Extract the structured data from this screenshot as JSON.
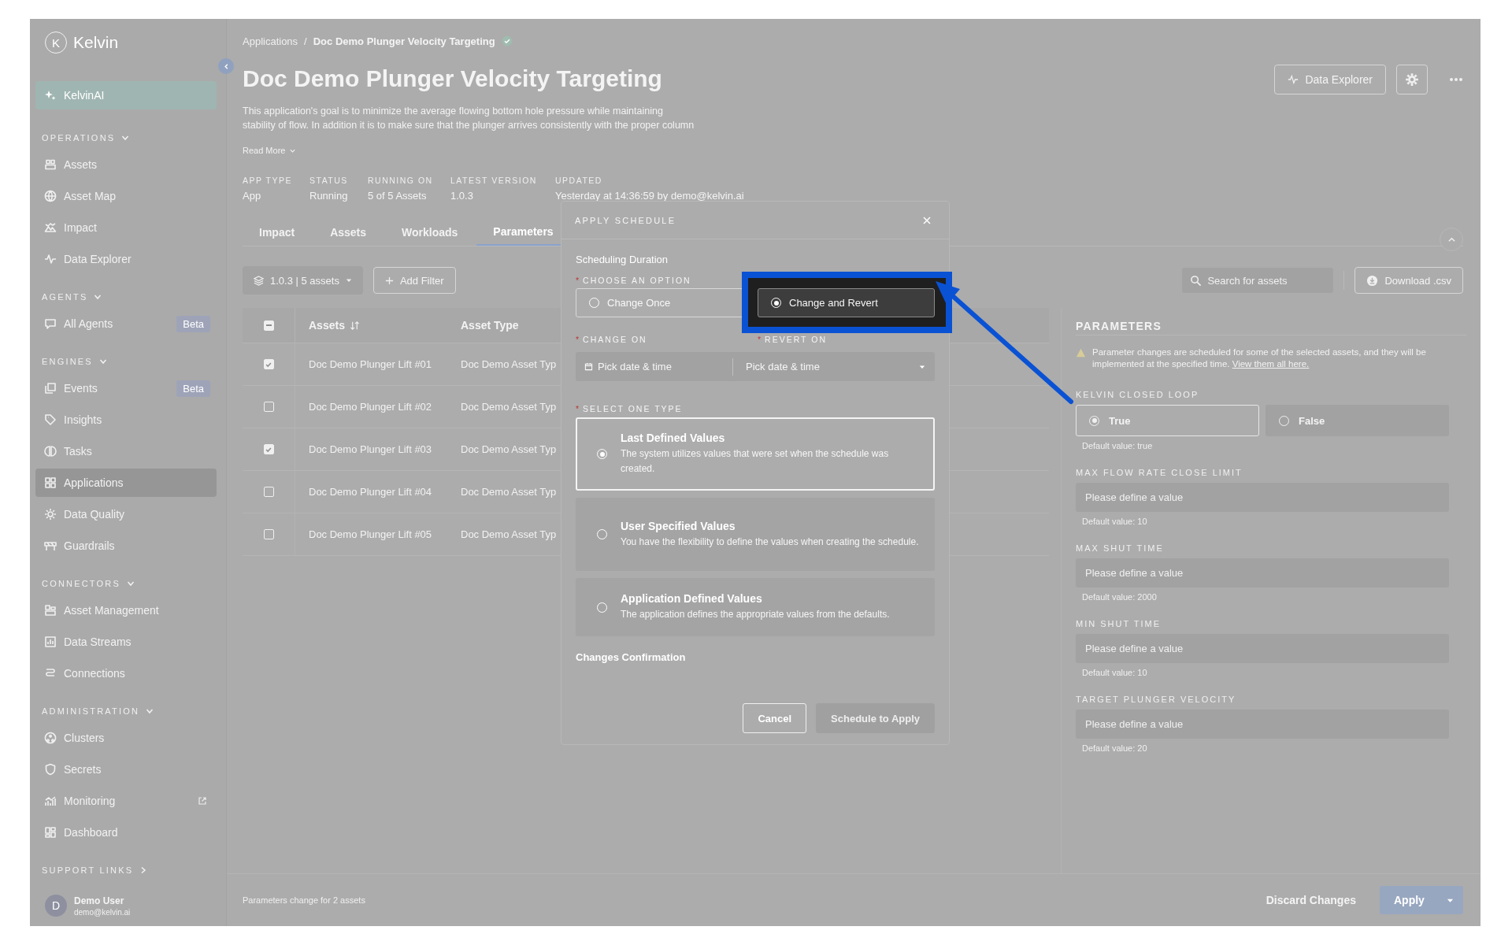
{
  "sidebar": {
    "logo_mark": "K",
    "logo": "Kelvin",
    "ai_button": "KelvinAI",
    "sections": [
      {
        "title": "OPERATIONS",
        "expanded": true,
        "items": [
          {
            "label": "Assets",
            "selected": false,
            "external": false
          },
          {
            "label": "Asset Map",
            "selected": false,
            "external": false
          },
          {
            "label": "Impact",
            "selected": false,
            "external": false
          },
          {
            "label": "Data Explorer",
            "selected": false,
            "external": false
          }
        ]
      },
      {
        "title": "AGENTS",
        "expanded": true,
        "items": [
          {
            "label": "All Agents",
            "selected": false,
            "external": false,
            "badge": "Beta"
          }
        ]
      },
      {
        "title": "ENGINES",
        "expanded": true,
        "items": [
          {
            "label": "Events",
            "selected": false,
            "external": false,
            "badge": "Beta"
          },
          {
            "label": "Insights",
            "selected": false,
            "external": false
          },
          {
            "label": "Tasks",
            "selected": false,
            "external": false
          },
          {
            "label": "Applications",
            "selected": true,
            "external": false
          },
          {
            "label": "Data Quality",
            "selected": false,
            "external": false
          },
          {
            "label": "Guardrails",
            "selected": false,
            "external": false
          }
        ]
      },
      {
        "title": "CONNECTORS",
        "expanded": true,
        "items": [
          {
            "label": "Asset Management",
            "selected": false,
            "external": false
          },
          {
            "label": "Data Streams",
            "selected": false,
            "external": false
          },
          {
            "label": "Connections",
            "selected": false,
            "external": false
          }
        ]
      },
      {
        "title": "ADMINISTRATION",
        "expanded": true,
        "items": [
          {
            "label": "Clusters",
            "selected": false,
            "external": false
          },
          {
            "label": "Secrets",
            "selected": false,
            "external": false
          },
          {
            "label": "Monitoring",
            "selected": false,
            "external": true
          },
          {
            "label": "Dashboard",
            "selected": false,
            "external": false
          }
        ]
      },
      {
        "title": "SUPPORT LINKS",
        "expanded": false
      }
    ],
    "user": {
      "avatar": "D",
      "name": "Demo User",
      "email": "demo@kelvin.ai"
    }
  },
  "breadcrumb": {
    "items": [
      "Applications",
      "Doc Demo Plunger Velocity Targeting"
    ],
    "separator": "/"
  },
  "title": "Doc Demo Plunger Velocity Targeting",
  "description_lines": [
    "This application's goal is to minimize the average flowing bottom hole pressure while maintaining",
    "stability of flow. In addition it is to make sure that the plunger arrives consistently with the proper column"
  ],
  "read_more": "Read More",
  "meta": [
    {
      "label": "APP TYPE",
      "value": "App"
    },
    {
      "label": "STATUS",
      "value": "Running"
    },
    {
      "label": "RUNNING ON",
      "value": "5 of 5 Assets"
    },
    {
      "label": "LATEST VERSION",
      "value": "1.0.3"
    },
    {
      "label": "UPDATED",
      "value": "Yesterday at 14:36:59 by demo@kelvin.ai"
    }
  ],
  "actions": {
    "data_explorer": "Data Explorer"
  },
  "tabs": [
    {
      "label": "Impact",
      "selected": false
    },
    {
      "label": "Assets",
      "selected": false
    },
    {
      "label": "Workloads",
      "selected": false
    },
    {
      "label": "Parameters",
      "selected": true
    }
  ],
  "filters": {
    "version": "1.0.3 | 5 assets",
    "add_filter": "Add Filter",
    "search_placeholder": "Search for assets",
    "download": "Download .csv"
  },
  "table": {
    "select_all": {
      "indeterminate": true
    },
    "columns": [
      "Assets",
      "Asset Type"
    ],
    "rows": [
      {
        "checked": true,
        "asset": "Doc Demo Plunger Lift #01",
        "type": "Doc Demo Asset Typ"
      },
      {
        "checked": false,
        "asset": "Doc Demo Plunger Lift #02",
        "type": "Doc Demo Asset Typ"
      },
      {
        "checked": true,
        "asset": "Doc Demo Plunger Lift #03",
        "type": "Doc Demo Asset Typ"
      },
      {
        "checked": false,
        "asset": "Doc Demo Plunger Lift #04",
        "type": "Doc Demo Asset Typ"
      },
      {
        "checked": false,
        "asset": "Doc Demo Plunger Lift #05",
        "type": "Doc Demo Asset Typ"
      }
    ]
  },
  "parameters": {
    "title": "PARAMETERS",
    "warning": "Parameter changes are scheduled for some of the selected assets, and they will be implemented at the specified time.",
    "warning_link": "View them all here.",
    "items": [
      {
        "kind": "radio",
        "label": "KELVIN CLOSED LOOP",
        "options": [
          {
            "label": "True",
            "selected": true
          },
          {
            "label": "False",
            "selected": false
          }
        ],
        "default": "Default value: true"
      },
      {
        "kind": "input",
        "label": "MAX FLOW RATE CLOSE LIMIT",
        "placeholder": "Please define a value",
        "default": "Default value: 10"
      },
      {
        "kind": "input",
        "label": "MAX SHUT TIME",
        "placeholder": "Please define a value",
        "default": "Default value: 2000"
      },
      {
        "kind": "input",
        "label": "MIN SHUT TIME",
        "placeholder": "Please define a value",
        "default": "Default value: 10"
      },
      {
        "kind": "input",
        "label": "TARGET PLUNGER VELOCITY",
        "placeholder": "Please define a value",
        "default": "Default value: 20"
      }
    ]
  },
  "footer": {
    "note": "Parameters change for 2 assets",
    "discard": "Discard Changes",
    "apply": "Apply"
  },
  "modal": {
    "title": "APPLY SCHEDULE",
    "section_title": "Scheduling Duration",
    "option_label": {
      "mark": "*",
      "text": "CHOOSE AN OPTION"
    },
    "options": [
      {
        "label": "Change Once",
        "selected": false,
        "highlighted": false
      },
      {
        "label": "Change and Revert",
        "selected": true,
        "highlighted": true
      }
    ],
    "change_on": {
      "mark": "*",
      "text": "CHANGE ON",
      "placeholder": "Pick date & time"
    },
    "revert_on": {
      "mark": "*",
      "text": "REVERT ON",
      "placeholder": "Pick date & time"
    },
    "type_label": {
      "mark": "*",
      "text": "SELECT ONE TYPE"
    },
    "types": [
      {
        "title": "Last Defined Values",
        "description": "The system utilizes values that were set when the schedule was created.",
        "selected": true
      },
      {
        "title": "User Specified Values",
        "description": "You have the flexibility to define the values when creating the schedule.",
        "selected": false
      },
      {
        "title": "Application Defined Values",
        "description": "The application defines the appropriate values from the defaults.",
        "selected": false
      }
    ],
    "confirmation": "Changes Confirmation",
    "buttons": [
      {
        "label": "Cancel",
        "disabled": false
      },
      {
        "label": "Schedule to Apply",
        "disabled": true
      }
    ]
  }
}
